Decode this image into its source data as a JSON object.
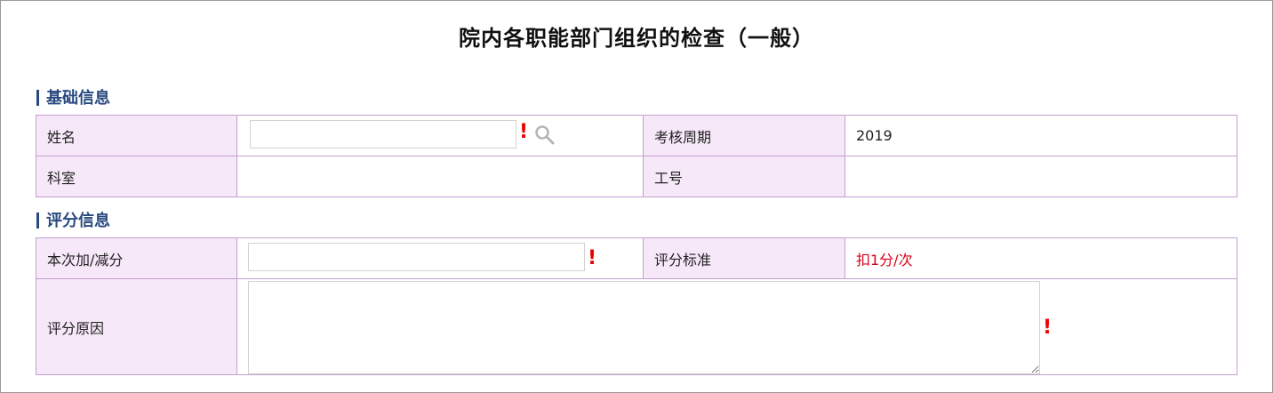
{
  "page": {
    "title": "院内各职能部门组织的检查（一般）"
  },
  "sections": {
    "basic": {
      "label": "基础信息"
    },
    "score": {
      "label": "评分信息"
    }
  },
  "basic_info": {
    "name_label": "姓名",
    "name_value": "",
    "period_label": "考核周期",
    "period_value": "2019",
    "dept_label": "科室",
    "dept_value": "",
    "id_label": "工号",
    "id_value": ""
  },
  "score_info": {
    "delta_label": "本次加/减分",
    "delta_value": "",
    "standard_label": "评分标准",
    "standard_value": "扣1分/次",
    "reason_label": "评分原因",
    "reason_value": ""
  },
  "required_mark": "!",
  "colors": {
    "label_bg": "#f6e8f8",
    "border": "#c3a0cf",
    "section_text": "#2a4a7f",
    "required": "#e00000",
    "standard_text": "#d9001b"
  },
  "icons": {
    "lookup": "search-icon"
  }
}
